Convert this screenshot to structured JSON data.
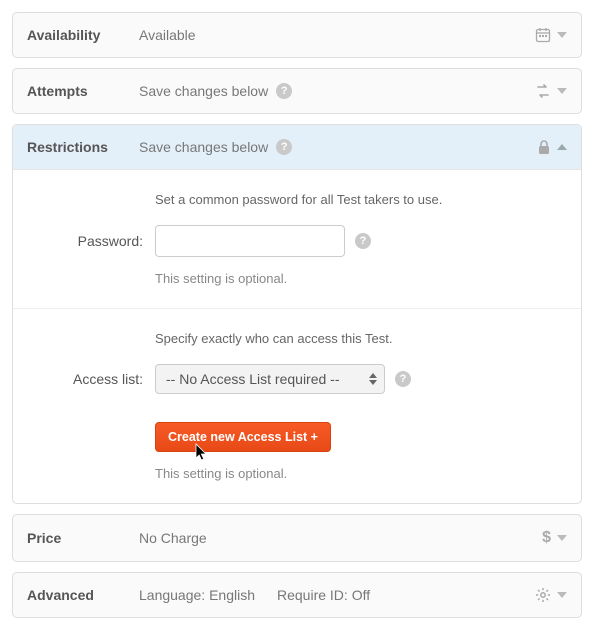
{
  "availability": {
    "title": "Availability",
    "summary": "Available"
  },
  "attempts": {
    "title": "Attempts",
    "summary": "Save changes below"
  },
  "restrictions": {
    "title": "Restrictions",
    "summary": "Save changes below",
    "password_section": {
      "description": "Set a common password for all Test takers to use.",
      "label": "Password:",
      "value": "",
      "hint": "This setting is optional."
    },
    "access_section": {
      "description": "Specify exactly who can access this Test.",
      "label": "Access list:",
      "selected": "-- No Access List required --",
      "button": "Create new Access List +",
      "hint": "This setting is optional."
    }
  },
  "price": {
    "title": "Price",
    "summary": "No Charge"
  },
  "advanced": {
    "title": "Advanced",
    "language_label": "Language:",
    "language_value": "English",
    "require_id_label": "Require ID:",
    "require_id_value": "Off"
  }
}
